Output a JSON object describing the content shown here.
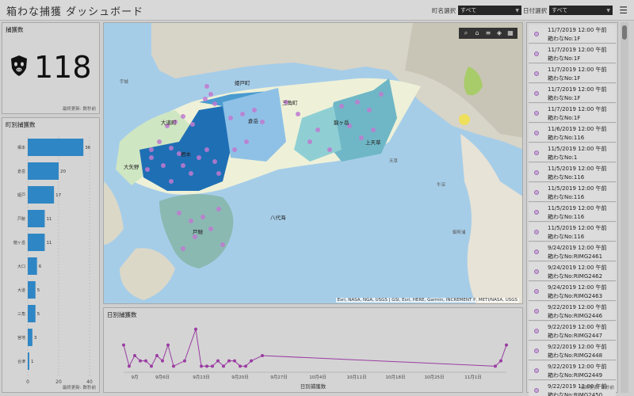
{
  "header": {
    "title": "箱わな捕獲 ダッシュボード",
    "town_filter_label": "町名選択",
    "town_filter_value": "すべて",
    "date_filter_label": "日付選択",
    "date_filter_value": "すべて"
  },
  "kpi": {
    "title": "捕獲数",
    "value": "118",
    "footnote": "最終更新: 数秒前"
  },
  "town_chart": {
    "title": "町別捕獲数",
    "footnote": "最終更新: 数秒前"
  },
  "map": {
    "attribution": "Esri, NASA, NGA, USGS | GSI, Esri, HERE, Garmin, INCREMENT P, METI/NASA, USGS",
    "labels": [
      "姫戸町",
      "大道町",
      "栖本",
      "倉岳",
      "龍ヶ岳",
      "上天草",
      "大矢野",
      "三角町",
      "宇城",
      "八代海",
      "戸馳",
      "天草",
      "牛深",
      "御所浦"
    ]
  },
  "daily_chart": {
    "title": "日別捕獲数",
    "xlabel": "日別捕獲数"
  },
  "list": {
    "items": [
      {
        "line1": "11/7/2019 12:00 午前",
        "line2": "箱わなNo:1F"
      },
      {
        "line1": "11/7/2019 12:00 午前",
        "line2": "箱わなNo:1F"
      },
      {
        "line1": "11/7/2019 12:00 午前",
        "line2": "箱わなNo:1F"
      },
      {
        "line1": "11/7/2019 12:00 午前",
        "line2": "箱わなNo:1F"
      },
      {
        "line1": "11/7/2019 12:00 午前",
        "line2": "箱わなNo:1F"
      },
      {
        "line1": "11/6/2019 12:00 午前",
        "line2": "箱わなNo:116"
      },
      {
        "line1": "11/5/2019 12:00 午前",
        "line2": "箱わなNo:1"
      },
      {
        "line1": "11/5/2019 12:00 午前",
        "line2": "箱わなNo:116"
      },
      {
        "line1": "11/5/2019 12:00 午前",
        "line2": "箱わなNo:116"
      },
      {
        "line1": "11/5/2019 12:00 午前",
        "line2": "箱わなNo:116"
      },
      {
        "line1": "11/5/2019 12:00 午前",
        "line2": "箱わなNo:116"
      },
      {
        "line1": "9/24/2019 12:00 午前",
        "line2": "箱わなNo:RIMG2461"
      },
      {
        "line1": "9/24/2019 12:00 午前",
        "line2": "箱わなNo:RIMG2462"
      },
      {
        "line1": "9/24/2019 12:00 午前",
        "line2": "箱わなNo:RIMG2463"
      },
      {
        "line1": "9/22/2019 12:00 午前",
        "line2": "箱わなNo:RIMG2446"
      },
      {
        "line1": "9/22/2019 12:00 午前",
        "line2": "箱わなNo:RIMG2447"
      },
      {
        "line1": "9/22/2019 12:00 午前",
        "line2": "箱わなNo:RIMG2448"
      },
      {
        "line1": "9/22/2019 12:00 午前",
        "line2": "箱わなNo:RIMG2449"
      },
      {
        "line1": "9/22/2019 12:00 午前",
        "line2": "箱わなNo:RIMG2450"
      }
    ],
    "footnote": "最終更新: 数秒前"
  },
  "chart_data": [
    {
      "type": "bar",
      "orientation": "horizontal",
      "title": "町別捕獲数",
      "categories": [
        "栖本",
        "倉岳",
        "姫戸",
        "戸馳",
        "龍ヶ岳",
        "大口",
        "大道",
        "三角",
        "宮地",
        "合津"
      ],
      "values": [
        36,
        20,
        17,
        11,
        11,
        6,
        5,
        5,
        3,
        1
      ],
      "xlim": [
        0,
        40
      ],
      "xticks": [
        0,
        20,
        40
      ],
      "grid": true
    },
    {
      "type": "line",
      "title": "日別捕獲数",
      "xlabel": "日別捕獲数",
      "tick_labels": [
        "9月",
        "9月6日",
        "9月13日",
        "9月20日",
        "9月27日",
        "10月4日",
        "10月11日",
        "10月18日",
        "10月25日",
        "11月1日"
      ],
      "series": [
        {
          "color": "#9b3ca3",
          "x": [
            "8/30",
            "8/31",
            "9/1",
            "9/2",
            "9/3",
            "9/4",
            "9/5",
            "9/6",
            "9/7",
            "9/8",
            "9/10",
            "9/12",
            "9/13",
            "9/14",
            "9/15",
            "9/16",
            "9/17",
            "9/18",
            "9/19",
            "9/20",
            "9/21",
            "9/22",
            "9/24",
            "11/5",
            "11/6",
            "11/7"
          ],
          "y": [
            5,
            1,
            3,
            2,
            2,
            1,
            3,
            2,
            5,
            1,
            2,
            8,
            1,
            1,
            1,
            2,
            1,
            2,
            2,
            1,
            1,
            2,
            3,
            1,
            2,
            5
          ]
        }
      ],
      "grid": false
    }
  ]
}
